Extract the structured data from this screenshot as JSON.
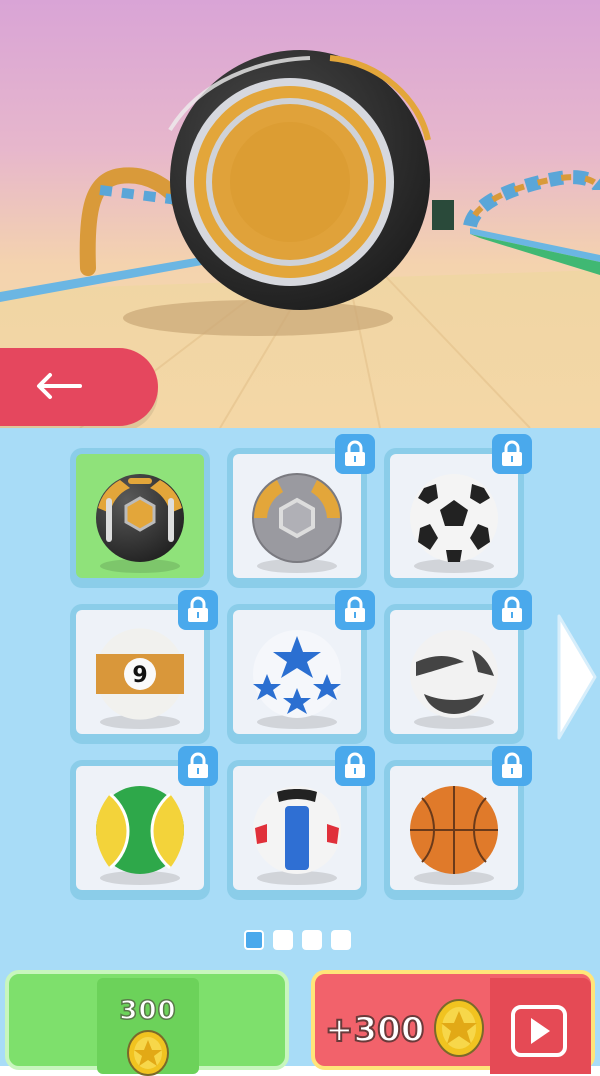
{
  "colors": {
    "back_button": "#e5475e",
    "panel_bg": "#a8dcf7",
    "selected_cell": "#8fe27a",
    "lock_badge": "#4aa9ec",
    "buy_button": "#7ee06c",
    "ad_button": "#f2626b"
  },
  "preview": {
    "ball": "gold-hexagon-ball"
  },
  "back_button": {
    "icon": "back-arrow-icon"
  },
  "balls": [
    {
      "name": "gold-hexagon-ball",
      "locked": false,
      "selected": true
    },
    {
      "name": "silver-hexagon-ball",
      "locked": true,
      "selected": false
    },
    {
      "name": "soccer-ball",
      "locked": true,
      "selected": false
    },
    {
      "name": "billiard-9-ball",
      "locked": true,
      "selected": false,
      "label": "9"
    },
    {
      "name": "blue-star-ball",
      "locked": true,
      "selected": false
    },
    {
      "name": "black-white-ball",
      "locked": true,
      "selected": false
    },
    {
      "name": "tennis-ball",
      "locked": true,
      "selected": false
    },
    {
      "name": "volleyball",
      "locked": true,
      "selected": false
    },
    {
      "name": "basketball",
      "locked": true,
      "selected": false
    }
  ],
  "pagination": {
    "current": 1,
    "total": 4
  },
  "buy_button": {
    "price": "300",
    "icon": "coin-icon"
  },
  "ad_button": {
    "reward": "+300",
    "icons": [
      "coin-icon",
      "play-video-icon"
    ]
  }
}
